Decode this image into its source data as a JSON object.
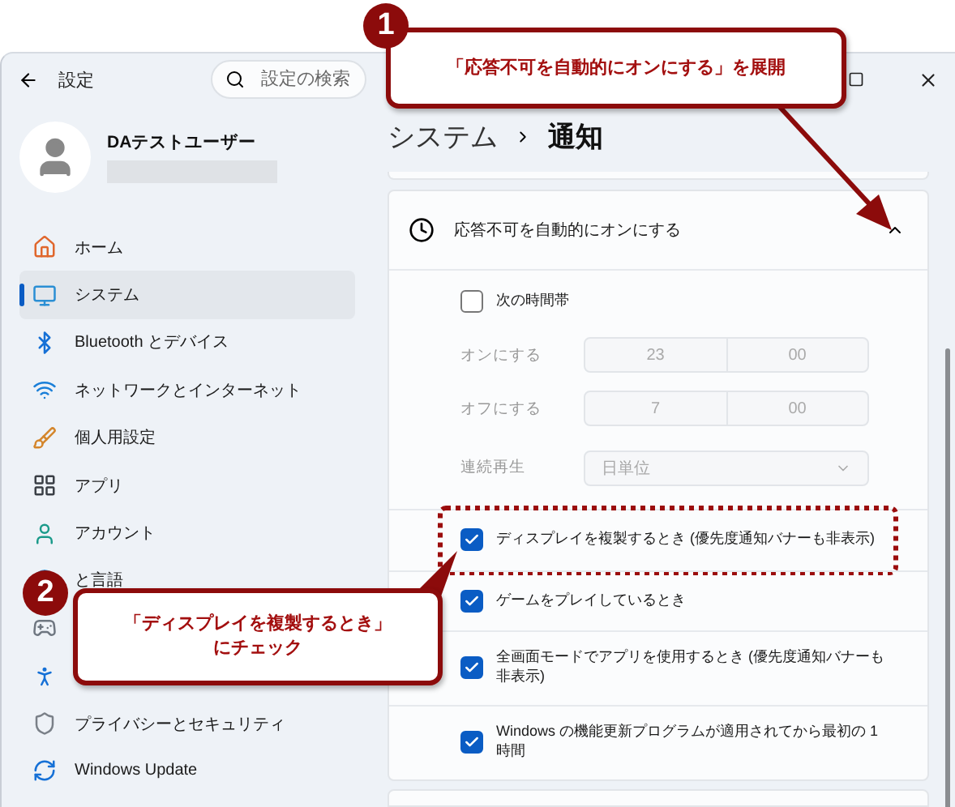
{
  "window": {
    "title": "設定",
    "search": {
      "placeholder": "設定の検索"
    }
  },
  "profile": {
    "name": "DAテストユーザー"
  },
  "sidebar": {
    "items": [
      {
        "label": "ホーム",
        "selected": false
      },
      {
        "label": "システム",
        "selected": true
      },
      {
        "label": "Bluetooth とデバイス",
        "selected": false
      },
      {
        "label": "ネットワークとインターネット",
        "selected": false
      },
      {
        "label": "個人用設定",
        "selected": false
      },
      {
        "label": "アプリ",
        "selected": false
      },
      {
        "label": "アカウント",
        "selected": false
      },
      {
        "label": "と言語",
        "selected": false
      },
      {
        "selected": false
      },
      {
        "selected": false
      },
      {
        "label": "プライバシーとセキュリティ",
        "selected": false
      },
      {
        "label": "Windows Update",
        "selected": false
      }
    ]
  },
  "breadcrumb": [
    "システム",
    "通知"
  ],
  "dnd_card": {
    "title": "応答不可を自動的にオンにする",
    "expanded": true,
    "schedule": {
      "label": "次の時間帯",
      "checked": false,
      "disabled": true,
      "rows": [
        {
          "label": "オンにする",
          "hour": "23",
          "minute": "00"
        },
        {
          "label": "オフにする",
          "hour": "7",
          "minute": "00"
        }
      ],
      "repeat": {
        "label": "連続再生",
        "value": "日単位"
      }
    },
    "options": [
      {
        "label": "ディスプレイを複製するとき (優先度通知バナーも非表示)",
        "checked": true,
        "highlighted": true
      },
      {
        "label": "ゲームをプレイしているとき",
        "checked": true,
        "highlighted": false
      },
      {
        "label": "全画面モードでアプリを使用するとき (優先度通知バナーも非表示)",
        "checked": true,
        "highlighted": false
      },
      {
        "label": "Windows の機能更新プログラムが適用されてから最初の 1 時間",
        "checked": true,
        "highlighted": false
      }
    ]
  },
  "callouts": [
    {
      "number": "1",
      "lines": [
        "「応答不可を自動的にオンにする」を展開"
      ]
    },
    {
      "number": "2",
      "lines": [
        "「ディスプレイを複製するとき」",
        "にチェック"
      ]
    }
  ]
}
